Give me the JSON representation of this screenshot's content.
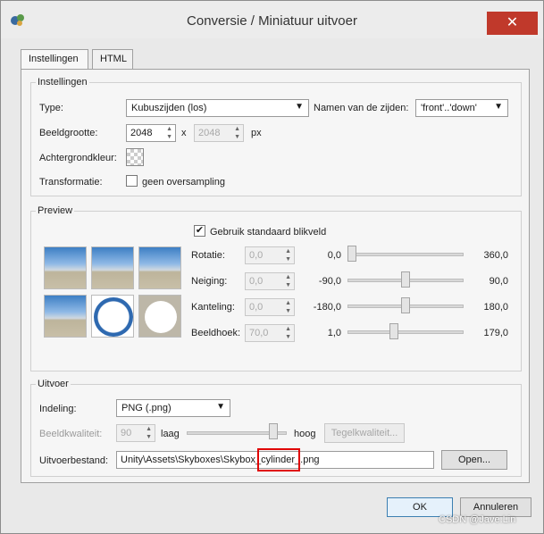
{
  "window": {
    "title": "Conversie / Miniatuur uitvoer",
    "close_glyph": "✕"
  },
  "tabs": [
    {
      "label": "Instellingen",
      "active": true
    },
    {
      "label": "HTML",
      "active": false
    }
  ],
  "settings": {
    "group_title": "Instellingen",
    "type_label": "Type:",
    "type_value": "Kubuszijden (los)",
    "names_label": "Namen van de zijden:",
    "names_value": "'front'..'down'",
    "size_label": "Beeldgrootte:",
    "width_value": "2048",
    "times": "x",
    "height_value": "2048",
    "unit": "px",
    "bg_label": "Achtergrondkleur:",
    "transform_label": "Transformatie:",
    "oversampling_label": "geen oversampling",
    "oversampling_checked": false
  },
  "preview": {
    "group_title": "Preview",
    "std_view_label": "Gebruik standaard blikveld",
    "std_view_checked": true,
    "check_glyph": "✔",
    "rows": [
      {
        "label": "Rotatie:",
        "value": "0,0",
        "min": "0,0",
        "max": "360,0",
        "position": 0.0
      },
      {
        "label": "Neiging:",
        "value": "0,0",
        "min": "-90,0",
        "max": "90,0",
        "position": 0.5
      },
      {
        "label": "Kanteling:",
        "value": "0,0",
        "min": "-180,0",
        "max": "180,0",
        "position": 0.5
      },
      {
        "label": "Beeldhoek:",
        "value": "70,0",
        "min": "1,0",
        "max": "179,0",
        "position": 0.39
      }
    ]
  },
  "output": {
    "group_title": "Uitvoer",
    "format_label": "Indeling:",
    "format_value": "PNG (.png)",
    "quality_label": "Beeldkwaliteit:",
    "quality_value": "90",
    "low_label": "laag",
    "high_label": "hoog",
    "quality_position": 0.9,
    "tile_quality_button": "Tegelkwaliteit...",
    "file_label": "Uitvoerbestand:",
    "file_value": "Unity\\Assets\\Skyboxes\\Skybox_cylinder_.png",
    "open_button": "Open..."
  },
  "footer": {
    "ok_button": "OK",
    "cancel_button": "Annuleren"
  },
  "watermark": "CSDN @Jave.Lin",
  "colors": {
    "highlight_box": "#e00000",
    "close": "#c0392b"
  }
}
